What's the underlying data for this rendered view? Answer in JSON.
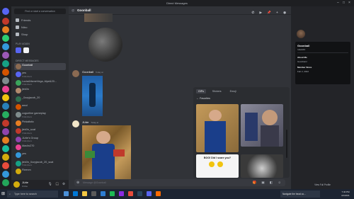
{
  "window": {
    "title": "Direct Messages"
  },
  "sidebar": {
    "search_placeholder": "Find or start a conversation",
    "nav": [
      {
        "label": "Friends"
      },
      {
        "label": "Nitro"
      },
      {
        "label": "Shop"
      }
    ],
    "play_again_header": "Play Again",
    "dm_header": "Direct Messages",
    "dms": [
      {
        "name": "Goonball",
        "sub": "",
        "color": "#8a6a52",
        "active": true
      },
      {
        "name": "yes",
        "sub": "5 Members",
        "color": "#5865f2"
      },
      {
        "name": "Lucia&ItsmeVega, Alpe&20...",
        "sub": "4 Members",
        "color": "#3ba55c"
      },
      {
        "name": "jlek0n",
        "sub": "",
        "color": "#b28a6d"
      },
      {
        "name": "_0zzyjacob_20",
        "sub": "",
        "color": "#2f6f4f"
      },
      {
        "name": "awol",
        "sub": "",
        "color": "#d35400"
      },
      {
        "name": "coguellne gameplay",
        "sub": "6 Members",
        "color": "#7f8c8d"
      },
      {
        "name": "Pinkallstic",
        "sub": "",
        "color": "#e67e22"
      },
      {
        "name": "jlek0n_scat",
        "sub": "3 Members",
        "color": "#c0392b"
      },
      {
        "name": "JUde's Group",
        "sub": "4 Members",
        "color": "#8e44ad"
      },
      {
        "name": "Mavlin270",
        "sub": "",
        "color": "#e84393"
      },
      {
        "name": "yes",
        "sub": "",
        "color": "#3498db"
      },
      {
        "name": "jlek0n_0zzyjacob_20_scat",
        "sub": "5 Members",
        "color": "#16a085"
      },
      {
        "name": "Fleenm",
        "sub": "",
        "color": "#d4ac0d"
      }
    ],
    "user": {
      "name": "JUde",
      "status": "Online"
    }
  },
  "chat": {
    "header_name": "Goonball",
    "messages": [
      {
        "author": "Goonball",
        "time": "Today at"
      },
      {
        "author": "JUde",
        "time": "Today at"
      }
    ],
    "input_placeholder": "Message @Goonball"
  },
  "gif_picker": {
    "tabs": [
      "GIFs",
      "Stickers",
      "Emoji"
    ],
    "active_tab": "GIFs",
    "section": "Favorites",
    "caption": "BOO! Did I scare you?"
  },
  "profile": {
    "name": "Goonball",
    "username": "rotteb43",
    "about_label": "About Me",
    "about_value": "Goonbanz",
    "member_since_label": "Member Since",
    "member_since_value": "Feb 2, 2022",
    "view_full": "View Full Profile"
  },
  "taskbar": {
    "search_placeholder": "Type here to search",
    "toast": "Navigate the head co...",
    "time": "7:40 PM",
    "date": "4/1/2021"
  },
  "colors": {
    "accent": "#5865f2",
    "online": "#23a55a",
    "bg": "#313338"
  }
}
